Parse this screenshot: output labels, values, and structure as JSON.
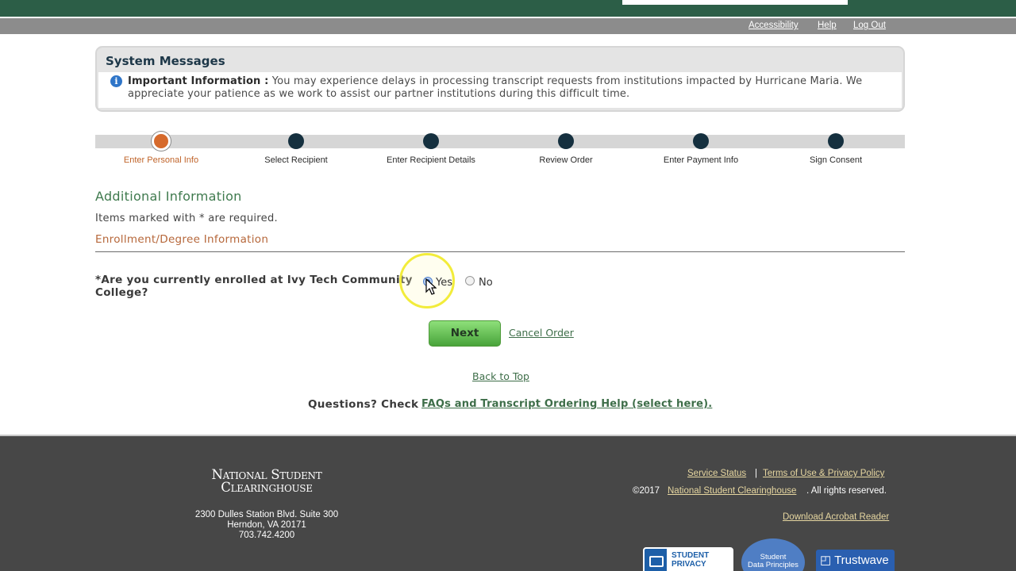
{
  "util_links": {
    "accessibility": "Accessibility",
    "help": "Help",
    "logout": "Log Out"
  },
  "system_messages": {
    "title": "System Messages",
    "info_icon": "info-icon",
    "important_label": "Important Information :",
    "text": "You may experience delays in processing transcript requests from institutions impacted by Hurricane Maria. We appreciate your patience as we work to assist our partner institutions during this difficult time."
  },
  "steps": {
    "current_index": 0,
    "items": [
      {
        "label": "Enter Personal Info"
      },
      {
        "label": "Select Recipient"
      },
      {
        "label": "Enter Recipient Details"
      },
      {
        "label": "Review Order"
      },
      {
        "label": "Enter Payment Info"
      },
      {
        "label": "Sign Consent"
      }
    ]
  },
  "form": {
    "heading": "Additional Information",
    "required_note": "Items marked with * are required.",
    "section_title": "Enrollment/Degree Information",
    "question": "*Are you currently enrolled at Ivy Tech Community College?",
    "options": [
      {
        "label": "Yes",
        "checked": true
      },
      {
        "label": "No",
        "checked": false
      }
    ],
    "next_label": "Next",
    "cancel_label": "Cancel Order",
    "back_to_top": "Back to Top",
    "questions_label": "Questions? Check",
    "faq_link": "FAQs and Transcript Ordering Help (select here)."
  },
  "footer": {
    "logo_line1": "National Student",
    "logo_line2": "Clearinghouse",
    "address_line1": "2300 Dulles Station Blvd. Suite 300",
    "address_line2": "Herndon, VA 20171",
    "phone": "703.742.4200",
    "service_status": "Service Status",
    "separator": "|",
    "terms": "Terms of Use & Privacy Policy",
    "copyright": "©2017",
    "nsc_link": "National Student Clearinghouse",
    "rights": ". All rights reserved.",
    "acrobat": "Download Acrobat Reader",
    "badge_privacy_line1": "STUDENT",
    "badge_privacy_line2": "PRIVACY",
    "badge_principles_line1": "Student",
    "badge_principles_line2": "Data Principles",
    "badge_trustwave": "Trustwave"
  },
  "colors": {
    "header_green": "#2c5e47",
    "active_step": "#d66a2c",
    "step_dot": "#15303f",
    "link_green": "#3e6e49",
    "footer_bg": "#474747"
  }
}
